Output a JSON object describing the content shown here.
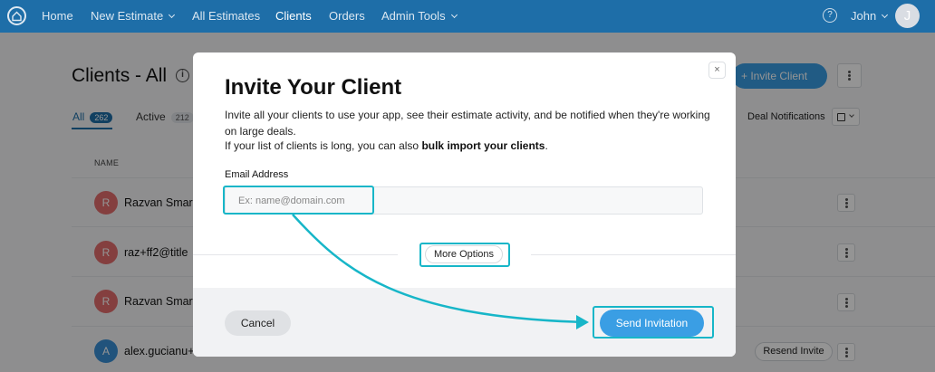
{
  "nav": {
    "items": [
      {
        "label": "Home"
      },
      {
        "label": "New Estimate"
      },
      {
        "label": "All Estimates"
      },
      {
        "label": "Clients"
      },
      {
        "label": "Orders"
      },
      {
        "label": "Admin Tools"
      }
    ],
    "help_glyph": "?",
    "user_name": "John",
    "user_initial": "J",
    "icons": [
      "home-logo-icon",
      "chevron-down-icon",
      "help-icon",
      "avatar"
    ]
  },
  "page": {
    "title": "Clients - All",
    "info_glyph": "i",
    "invite_button": "+ Invite Client",
    "tabs": [
      {
        "label": "All",
        "count": "262"
      },
      {
        "label": "Active",
        "count": "212"
      }
    ],
    "deal_notifications": "Deal Notifications",
    "column_name": "NAME",
    "rows": [
      {
        "initial": "R",
        "name": "Razvan Smara",
        "color": "#e36d6d"
      },
      {
        "initial": "R",
        "name": "raz+ff2@title",
        "color": "#e36d6d"
      },
      {
        "initial": "R",
        "name": "Razvan Smara",
        "color": "#e36d6d"
      },
      {
        "initial": "A",
        "name": "alex.gucianu+",
        "color": "#3a8fd6"
      }
    ],
    "resend_invite": "Resend Invite"
  },
  "modal": {
    "close_glyph": "×",
    "title": "Invite Your Client",
    "description": "Invite all your clients to use your app, see their estimate activity, and be notified when they're working on large deals.",
    "bulk_prefix": "If your list of clients is long, you can also ",
    "bulk_link": "bulk import your clients",
    "bulk_suffix": ".",
    "email_label": "Email Address",
    "email_placeholder": "Ex: name@domain.com",
    "email_value": "",
    "more_options": "More Options",
    "cancel": "Cancel",
    "send": "Send Invitation"
  },
  "colors": {
    "nav_bg": "#1e6ea8",
    "accent_button": "#3a9ee4",
    "highlight": "#17b6c8"
  }
}
